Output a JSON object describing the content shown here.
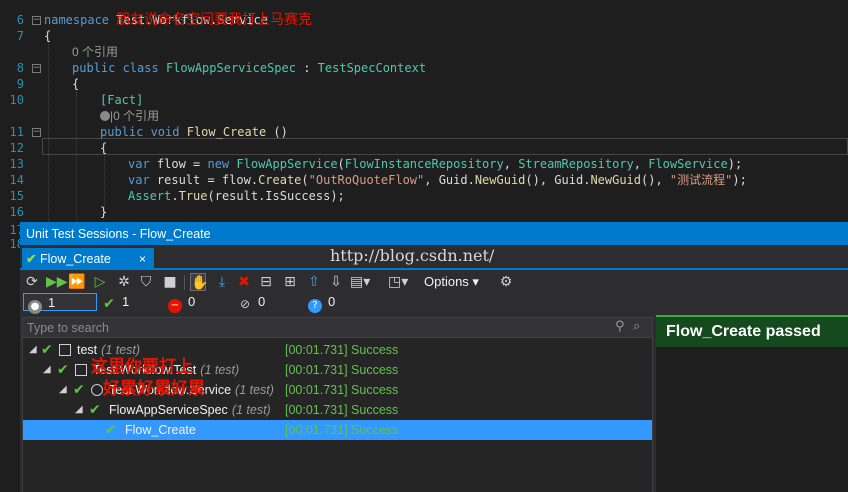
{
  "editor": {
    "line_numbers": [
      "6",
      "7",
      "",
      "8",
      "9",
      "10",
      "",
      "11",
      "12",
      "13",
      "14",
      "15",
      "16",
      "17",
      "18"
    ],
    "lines": {
      "namespace_kw": "namespace",
      "namespace_name": "Test.Workflow.Service",
      "brace_open": "{",
      "refs_class": "0 个引用",
      "class_kw": "public class",
      "class_name": "FlowAppServiceSpec",
      "class_sep": " : ",
      "base_class": "TestSpecContext",
      "class_brace": "{",
      "attribute": "[Fact]",
      "refs_method": "|0 个引用",
      "method_kw": "public void",
      "method_name": "Flow_Create",
      "method_params": " ()",
      "method_brace": "{",
      "l13_var": "var",
      "l13_rest": " flow = ",
      "l13_new": "new",
      "l13_type": " FlowAppService",
      "l13_args1": "(",
      "l13_t1": "FlowInstanceRepository",
      "l13_c1": ", ",
      "l13_t2": "StreamRepository",
      "l13_c2": ", ",
      "l13_t3": "FlowService",
      "l13_end": ");",
      "l14_var": "var",
      "l14_rest": " result = flow.",
      "l14_method": "Create",
      "l14_open": "(",
      "l14_str1": "\"OutRoQuoteFlow\"",
      "l14_mid": ", Guid.",
      "l14_m1": "NewGuid",
      "l14_mid2": "(), Guid.",
      "l14_m2": "NewGuid",
      "l14_mid3": "(), ",
      "l14_str2": "\"测试流程\"",
      "l14_end": ");",
      "l15_type": "Assert",
      "l15_dot": ".",
      "l15_method": "True",
      "l15_rest": "(result.",
      "l15_prop": "IsSuccess",
      "l15_end": ");",
      "brace_close": "}"
    },
    "red_annotation_top": "朋友说命名空间要我打上马赛克"
  },
  "unit_test": {
    "window_title": "Unit Test Sessions - Flow_Create",
    "tab_check": "✔",
    "tab_label": "Flow_Create",
    "tab_close": "×",
    "options_label": "Options ▾",
    "filters": {
      "all": "1",
      "passed": "1",
      "failed": "0",
      "ignored": "0",
      "unknown": "0"
    },
    "search_placeholder": "Type to search",
    "tree": [
      {
        "name": "test",
        "count": "(1 test)",
        "result": "[00:01.731] Success"
      },
      {
        "name": "Test.Workflow.Test",
        "count": "(1 test)",
        "result": "[00:01.731] Success"
      },
      {
        "name": "Test.Workflow.Service",
        "count": "(1 test)",
        "result": "[00:01.731] Success"
      },
      {
        "name": "FlowAppServiceSpec",
        "count": "(1 test)",
        "result": "[00:01.731] Success"
      },
      {
        "name": "Flow_Create",
        "count": "",
        "result": "[00:01.731] Success"
      }
    ],
    "result_title": "Flow_Create passed",
    "red_annotation_1": "这里你要打上",
    "red_annotation_2": "好累好累好累"
  },
  "watermark": "http://blog.csdn.net/",
  "colors": {
    "accent": "#007acc",
    "success": "#62c34a",
    "selection": "#3399ff",
    "annotation": "#e51400"
  }
}
